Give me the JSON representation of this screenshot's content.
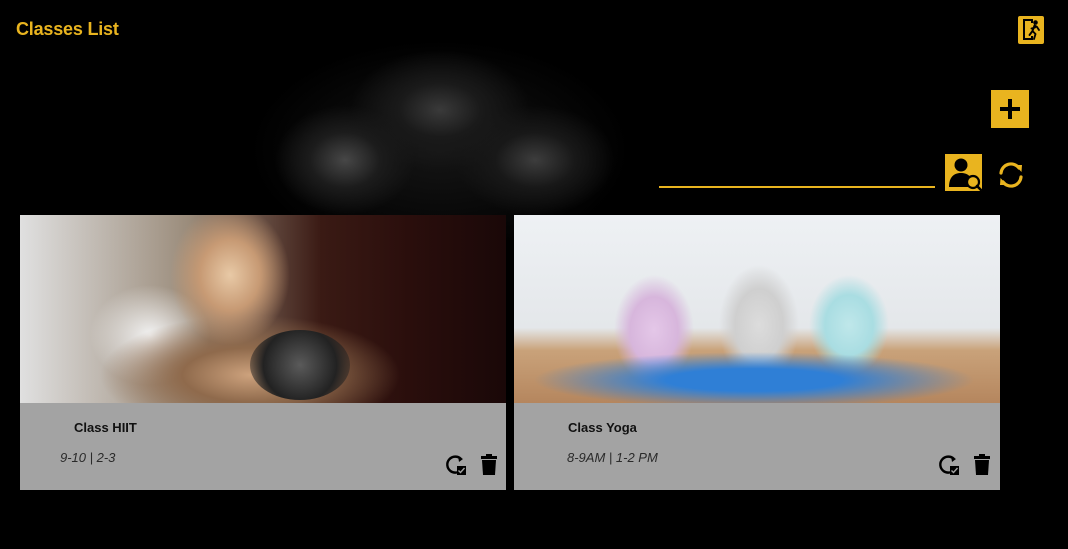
{
  "header": {
    "title": "Classes List"
  },
  "toolbar": {
    "exit_icon": "exit-running-man-icon",
    "add_icon": "plus-icon",
    "search_icon": "user-search-icon",
    "refresh_icon": "refresh-icon",
    "search_value": ""
  },
  "colors": {
    "accent": "#e9b41f",
    "background": "#000000",
    "card": "#a3a3a3"
  },
  "classes": [
    {
      "name": "Class HIIT",
      "time": "9-10 | 2-3",
      "image": "hiit-woman-training",
      "reschedule_icon": "reschedule-icon",
      "delete_icon": "trash-icon"
    },
    {
      "name": "Class Yoga",
      "time": "8-9AM | 1-2 PM",
      "image": "yoga-group-stretching",
      "reschedule_icon": "reschedule-icon",
      "delete_icon": "trash-icon"
    }
  ]
}
